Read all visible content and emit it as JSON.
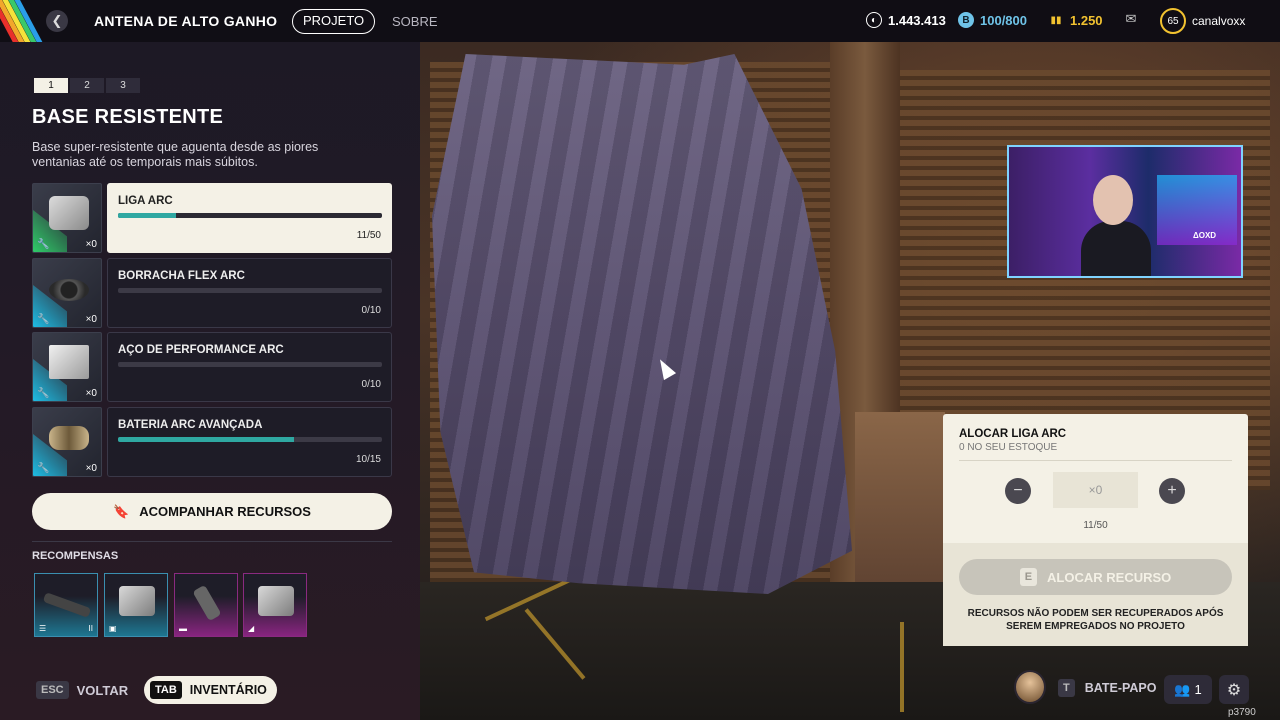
{
  "header": {
    "title": "ANTENA DE ALTO GANHO",
    "tabs": [
      {
        "label": "PROJETO",
        "active": true
      },
      {
        "label": "SOBRE",
        "active": false
      }
    ],
    "currencies": [
      {
        "icon": "coin-icon",
        "value": "1.443.413",
        "color": "#ffffff"
      },
      {
        "icon": "token-icon",
        "value": "100/800",
        "color": "#6fc3e8"
      },
      {
        "icon": "ticket-icon",
        "value": "1.250",
        "color": "#f2c230"
      }
    ],
    "level": "65",
    "username": "canalvoxx"
  },
  "steps": [
    "1",
    "2",
    "3"
  ],
  "active_step": 0,
  "section": {
    "title": "BASE RESISTENTE",
    "description": "Base super-resistente que aguenta desde as piores ventanias até os temporais mais súbitos."
  },
  "resources": [
    {
      "name": "LIGA ARC",
      "current": 11,
      "total": 50,
      "count": "11/50",
      "qty": "×0",
      "active": true,
      "rarity_color": "#2fd06a"
    },
    {
      "name": "BORRACHA FLEX ARC",
      "current": 0,
      "total": 10,
      "count": "0/10",
      "qty": "×0",
      "active": false,
      "rarity_color": "#1ec0e8"
    },
    {
      "name": "AÇO DE PERFORMANCE ARC",
      "current": 0,
      "total": 10,
      "count": "0/10",
      "qty": "×0",
      "active": false,
      "rarity_color": "#1ec0e8"
    },
    {
      "name": "BATERIA ARC AVANÇADA",
      "current": 10,
      "total": 15,
      "count": "10/15",
      "qty": "×0",
      "active": false,
      "rarity_color": "#1ec0e8"
    }
  ],
  "track_button": {
    "label": "ACOMPANHAR RECURSOS",
    "icon": "bookmark-icon"
  },
  "rewards": {
    "label": "RECOMPENSAS",
    "items": [
      {
        "name": "reward-rifle",
        "rarity_color": "#1ec0e8",
        "badge_right": "II"
      },
      {
        "name": "reward-armor",
        "rarity_color": "#1ec0e8",
        "badge_right": ""
      },
      {
        "name": "reward-attachment",
        "rarity_color": "#e02bc8",
        "badge_right": ""
      },
      {
        "name": "reward-gloves",
        "rarity_color": "#e02bc8",
        "badge_right": ""
      }
    ]
  },
  "bottom_left": {
    "esc_key": "ESC",
    "esc_label": "VOLTAR",
    "tab_key": "TAB",
    "tab_label": "INVENTÁRIO"
  },
  "allocate": {
    "title": "ALOCAR LIGA ARC",
    "subtitle": "0 NO SEU ESTOQUE",
    "value": "×0",
    "count": "11/50",
    "button_key": "E",
    "button_label": "ALOCAR RECURSO",
    "note": "RECURSOS NÃO PODEM SER RECUPERADOS APÓS SEREM EMPREGADOS NO PROJETO"
  },
  "bottom_right": {
    "chat_key": "T",
    "chat_label": "BATE-PAPO",
    "friends_count": "1",
    "version": "p3790"
  },
  "webcam": {
    "logo": "ΔOXD"
  }
}
